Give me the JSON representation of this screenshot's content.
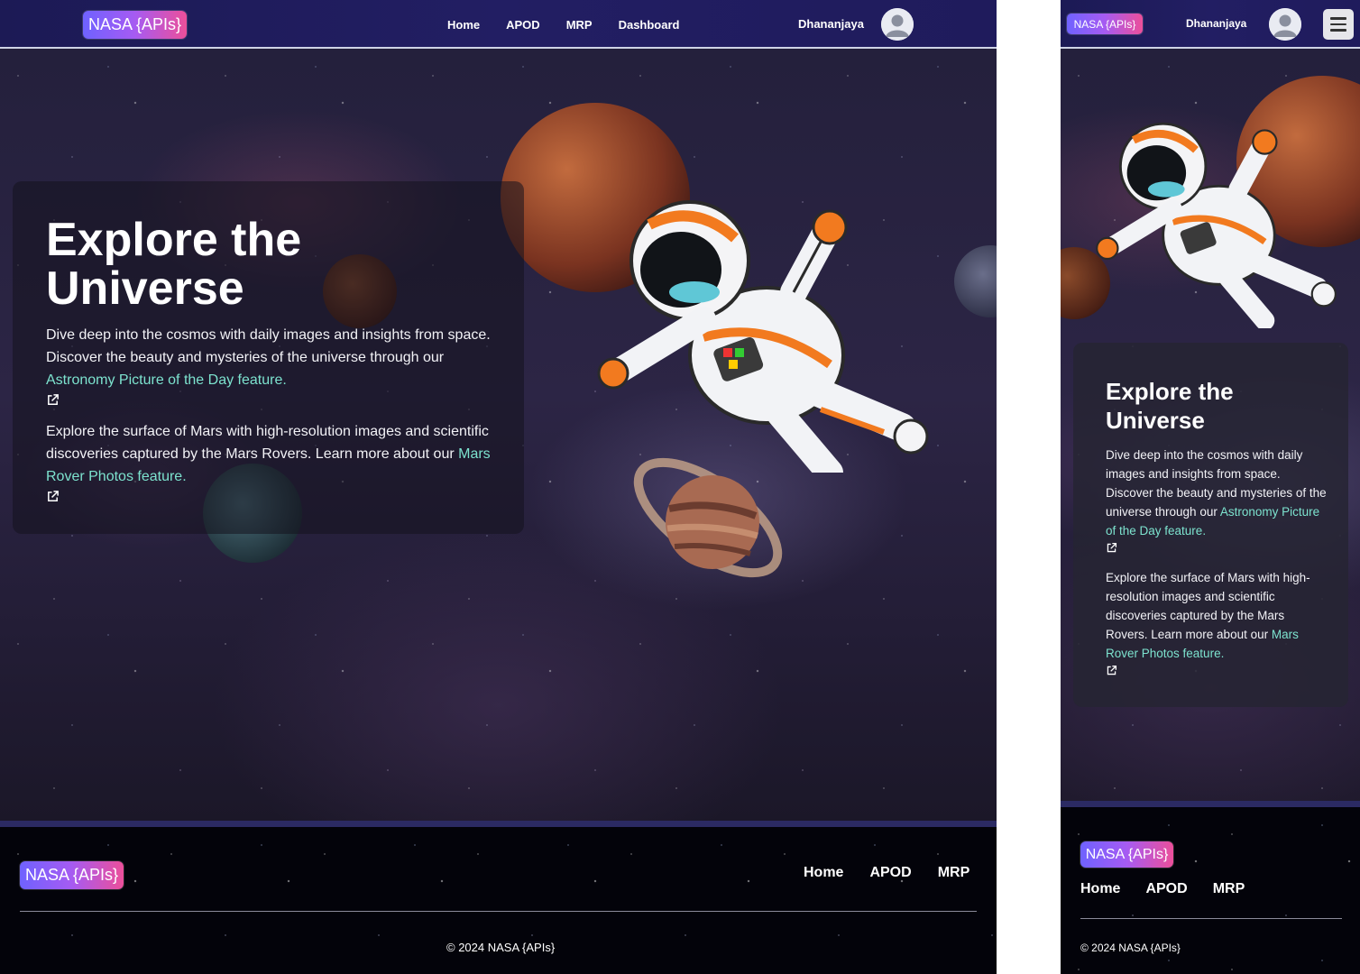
{
  "brand": {
    "logo": "NASA {APIs}",
    "gradient": [
      "#6f62ff",
      "#a65bf2",
      "#ec4f9a"
    ]
  },
  "nav": {
    "items": [
      "Home",
      "APOD",
      "MRP",
      "Dashboard"
    ]
  },
  "user": {
    "name": "Dhananjaya",
    "avatar_icon": "user-avatar-icon"
  },
  "hero": {
    "title": "Explore the Universe",
    "p1_text": "Dive deep into the cosmos with daily images and insights from space. Discover the beauty and mysteries of the universe through our ",
    "p1_link": "Astronomy Picture of the Day feature.",
    "p2_text": "Explore the surface of Mars with high-resolution images and scientific discoveries captured by the Mars Rovers. Learn more about our ",
    "p2_link": "Mars Rover Photos feature.",
    "link_icon": "external-link-icon",
    "link_color": "#7de3cf"
  },
  "footer": {
    "logo": "NASA {APIs}",
    "links": [
      "Home",
      "APOD",
      "MRP"
    ],
    "copyright": "© 2024 NASA {APIs}"
  },
  "mobile": {
    "menu_icon": "hamburger-menu-icon"
  }
}
